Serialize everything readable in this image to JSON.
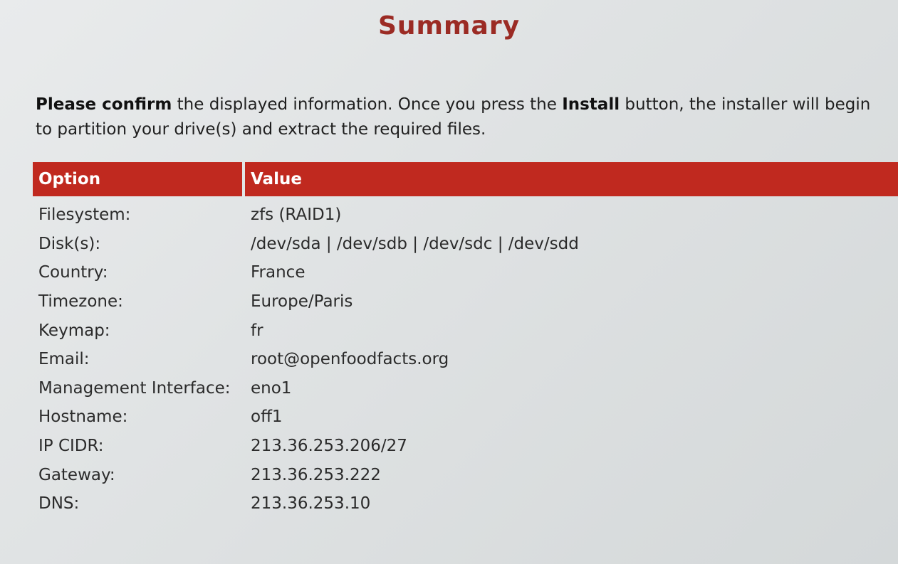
{
  "title": "Summary",
  "intro": {
    "bold_1": "Please confirm",
    "text_1": " the displayed information. Once you press the ",
    "bold_2": "Install",
    "text_2": " button, the installer will begin to partition your drive(s) and extract the required files."
  },
  "table": {
    "headers": {
      "option": "Option",
      "value": "Value"
    },
    "rows": [
      {
        "option": "Filesystem:",
        "value": "zfs (RAID1)"
      },
      {
        "option": "Disk(s):",
        "value": "/dev/sda | /dev/sdb | /dev/sdc | /dev/sdd"
      },
      {
        "option": "Country:",
        "value": "France"
      },
      {
        "option": "Timezone:",
        "value": "Europe/Paris"
      },
      {
        "option": "Keymap:",
        "value": "fr"
      },
      {
        "option": "Email:",
        "value": "root@openfoodfacts.org"
      },
      {
        "option": "Management Interface:",
        "value": "eno1"
      },
      {
        "option": "Hostname:",
        "value": "off1"
      },
      {
        "option": "IP CIDR:",
        "value": "213.36.253.206/27"
      },
      {
        "option": "Gateway:",
        "value": "213.36.253.222"
      },
      {
        "option": "DNS:",
        "value": "213.36.253.10"
      }
    ]
  },
  "colors": {
    "accent": "#c0291f",
    "title": "#9b2b24"
  }
}
